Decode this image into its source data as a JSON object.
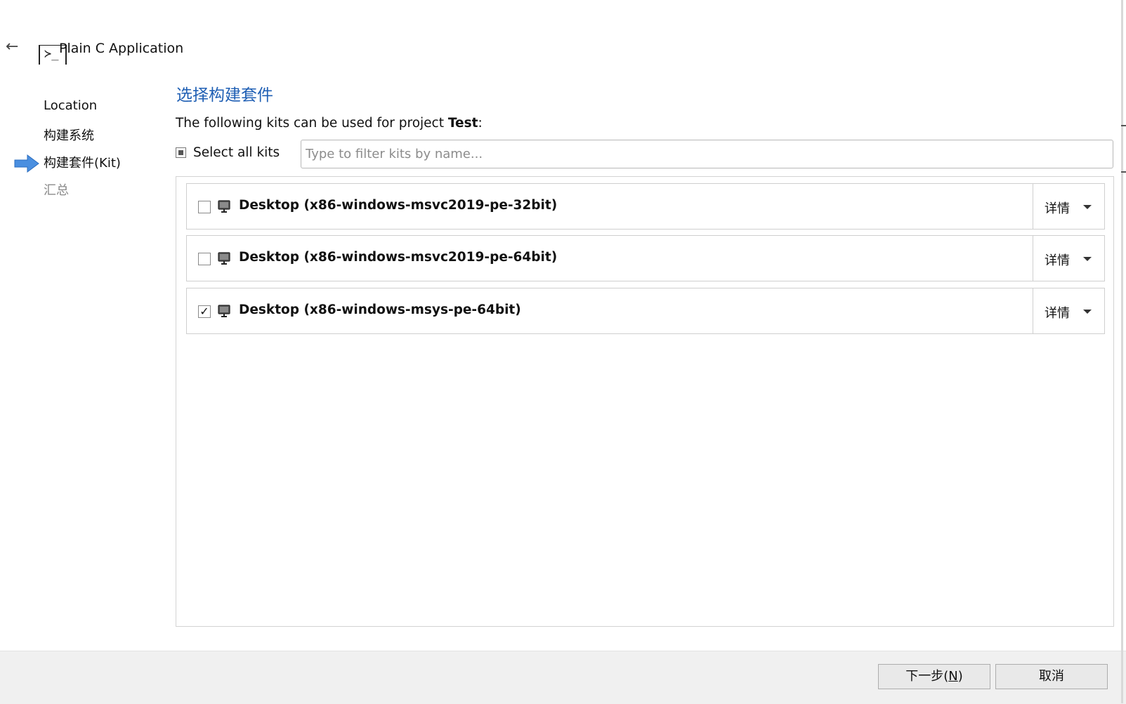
{
  "header": {
    "back_label": "←",
    "icon_glyph": "≻_",
    "title": "Plain C Application"
  },
  "steps": [
    {
      "label": "Location",
      "state": "done"
    },
    {
      "label": "构建系统",
      "state": "done"
    },
    {
      "label": "构建套件(Kit)",
      "state": "current"
    },
    {
      "label": "汇总",
      "state": "pending"
    }
  ],
  "page": {
    "heading": "选择构建套件",
    "intro_prefix": "The following kits can be used for project ",
    "project_name": "Test",
    "intro_suffix": ":",
    "select_all_label": "Select all kits",
    "select_all_state": "partial",
    "filter_placeholder": "Type to filter kits by name...",
    "filter_value": ""
  },
  "kits": [
    {
      "name": "Desktop (x86-windows-msvc2019-pe-32bit)",
      "checked": false,
      "check_mark": "",
      "details_label": "详情"
    },
    {
      "name": "Desktop (x86-windows-msvc2019-pe-64bit)",
      "checked": false,
      "check_mark": "",
      "details_label": "详情"
    },
    {
      "name": "Desktop (x86-windows-msys-pe-64bit)",
      "checked": true,
      "check_mark": "✓",
      "details_label": "详情"
    }
  ],
  "footer": {
    "next_label": "下一步(",
    "next_mnemonic": "N",
    "next_suffix": ")",
    "cancel_label": "取消"
  },
  "colors": {
    "heading": "#1f5fb4",
    "arrow_fill": "#4a8fe0",
    "footer_bg": "#f0f0f0"
  },
  "icons": {
    "back": "arrow-left-icon",
    "app": "terminal-icon",
    "step": "arrow-right-icon",
    "kit": "monitor-icon",
    "details": "chevron-down-icon"
  }
}
